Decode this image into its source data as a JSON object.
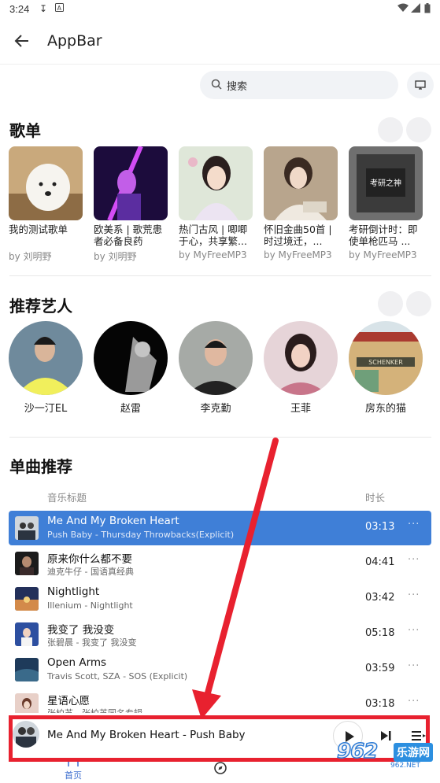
{
  "status_bar": {
    "time": "3:24"
  },
  "app_bar": {
    "title": "AppBar"
  },
  "search": {
    "placeholder": "搜索"
  },
  "sections": {
    "playlists": "歌单",
    "artists": "推荐艺人",
    "songs": "单曲推荐"
  },
  "playlists": [
    {
      "name": "我的测试歌单",
      "by": "by 刘明野"
    },
    {
      "name": "欧美系 | 歌荒患者必备良药",
      "by": "by 刘明野"
    },
    {
      "name": "热门古风 | 唧唧于心，共享繁...",
      "by": "by MyFreeMP3"
    },
    {
      "name": "怀旧金曲50首 | 时过境迁，...",
      "by": "by MyFreeMP3"
    },
    {
      "name": "考研倒计时：即使单枪匹马 ...",
      "by": "by MyFreeMP3"
    }
  ],
  "playlist_cover_text": "考研之神",
  "artists": [
    "沙一汀EL",
    "赵雷",
    "李克勤",
    "王菲",
    "房东的猫"
  ],
  "artist_sign_text": "SCHENKER",
  "song_columns": {
    "title": "音乐标题",
    "duration": "时长"
  },
  "songs": [
    {
      "title": "Me And My Broken Heart",
      "subtitle": "Push Baby - Thursday Throwbacks(Explicit)",
      "duration": "03:13",
      "active": true
    },
    {
      "title": "原来你什么都不要",
      "subtitle": "迪克牛仔 - 国语真经典",
      "duration": "04:41"
    },
    {
      "title": "Nightlight",
      "subtitle": "Illenium - Nightlight",
      "duration": "03:42"
    },
    {
      "title": "我变了 我没变",
      "subtitle": "张碧晨 - 我变了 我没变",
      "duration": "05:18"
    },
    {
      "title": "Open Arms",
      "subtitle": "Travis Scott, SZA - SOS (Explicit)",
      "duration": "03:59"
    },
    {
      "title": "星语心愿",
      "subtitle": "张柏芝 - 张柏芝同名专辑",
      "duration": "03:18"
    }
  ],
  "more_glyph": "···",
  "player": {
    "now_playing": "Me And My Broken Heart - Push Baby"
  },
  "bottom_nav": {
    "home": "首页"
  },
  "watermark": {
    "number": "962",
    "label": "乐游网",
    "url": "962.NET"
  },
  "colors": {
    "accent": "#3f7fd7",
    "annotation_red": "#e8212f"
  }
}
